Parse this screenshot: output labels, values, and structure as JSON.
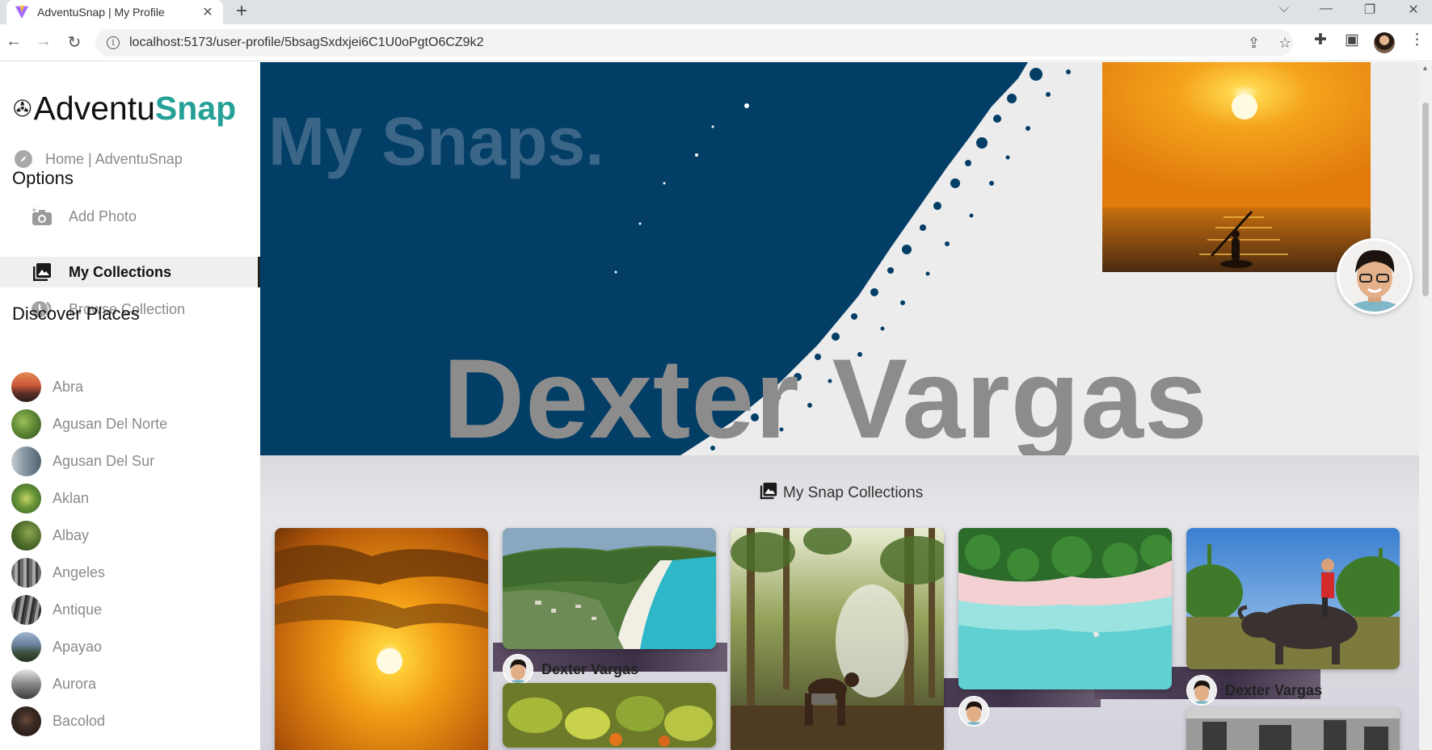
{
  "browser": {
    "tab_title": "AdventuSnap | My Profile",
    "tab_close": "✕",
    "new_tab": "+",
    "url": "localhost:5173/user-profile/5bsagSxdxjei6C1U0oPgtO6CZ9k2"
  },
  "sidebar": {
    "logo_part1": "AdventuSnap",
    "logo_plain": "Adventu",
    "logo_accent": "Snap",
    "home_label": "Home | AdventuSnap",
    "options_title": "Options",
    "options": [
      {
        "label": "Add Photo",
        "icon": "add-photo-icon"
      },
      {
        "label": "My Collections",
        "icon": "collections-icon",
        "active": true
      },
      {
        "label": "Browse Collection",
        "icon": "browse-icon"
      }
    ],
    "discover_title": "Discover Places",
    "places": [
      "Abra",
      "Agusan Del Norte",
      "Agusan Del Sur",
      "Aklan",
      "Albay",
      "Angeles",
      "Antique",
      "Apayao",
      "Aurora",
      "Bacolod"
    ]
  },
  "hero": {
    "title": "My Snaps.",
    "name": "Dexter Vargas"
  },
  "collections": {
    "title": "My Snap Collections",
    "cards": [
      {
        "author": "Dexter Vargas"
      },
      {
        "author": "Dexter Vargas"
      },
      {
        "author": "Dexter Vargas"
      }
    ]
  },
  "colors": {
    "accent": "#24a096",
    "hero_navy": "#023e66",
    "hero_title": "#3b6688"
  }
}
